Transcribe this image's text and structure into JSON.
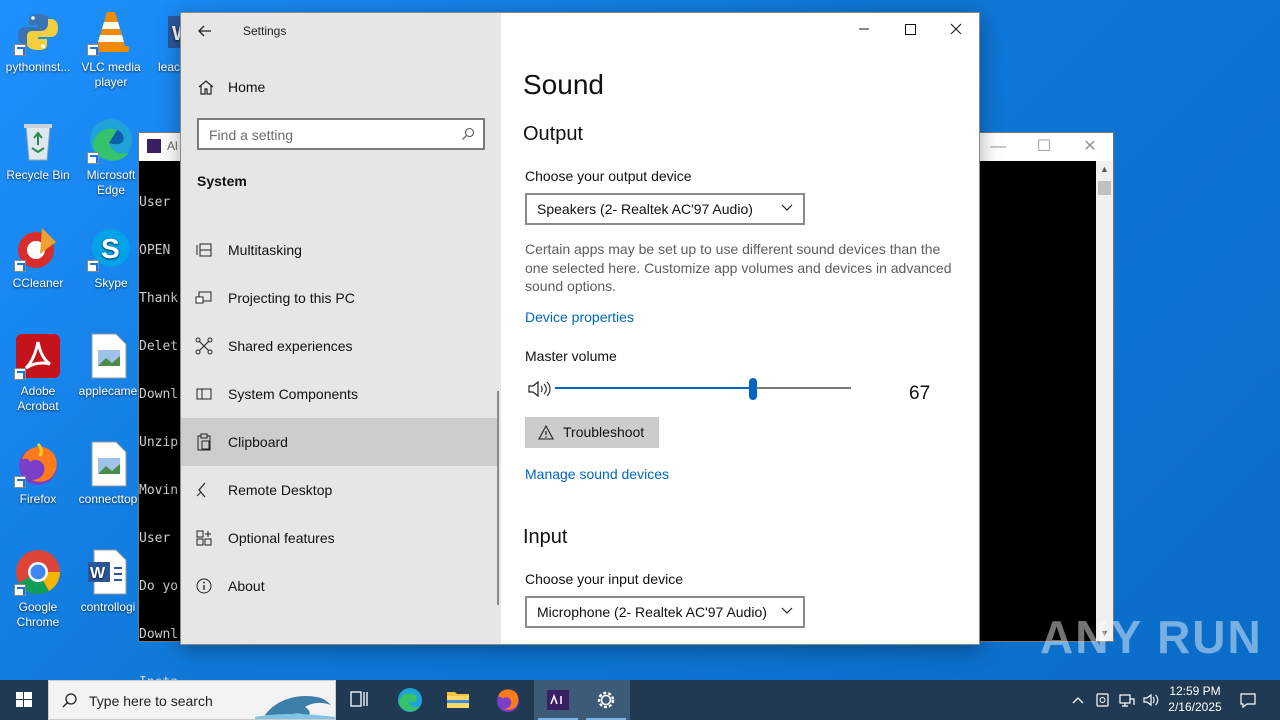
{
  "desktop": {
    "icons": [
      {
        "label": "pythoninst...",
        "icon": "python-icon"
      },
      {
        "label": "VLC media player",
        "icon": "vlc-icon"
      },
      {
        "label": "leac",
        "icon": "word-icon"
      },
      {
        "label": "Recycle Bin",
        "icon": "recycle-bin-icon"
      },
      {
        "label": "Microsoft Edge",
        "icon": "edge-icon"
      },
      {
        "label": "CCleaner",
        "icon": "ccleaner-icon"
      },
      {
        "label": "Skype",
        "icon": "skype-icon"
      },
      {
        "label": "Adobe Acrobat",
        "icon": "acrobat-icon"
      },
      {
        "label": "applecame",
        "icon": "image-file-icon"
      },
      {
        "label": "Firefox",
        "icon": "firefox-icon"
      },
      {
        "label": "connecttop",
        "icon": "image-file-icon"
      },
      {
        "label": "Google Chrome",
        "icon": "chrome-icon"
      },
      {
        "label": "controllogi",
        "icon": "word-doc-icon"
      }
    ]
  },
  "console": {
    "title": "Al",
    "lines": [
      "User",
      "OPEN",
      "Thank",
      "Delet",
      "Downl",
      "Unzip",
      "Movin",
      "User",
      "Do yo",
      "Downl",
      "Insta"
    ]
  },
  "settings": {
    "window_title": "Settings",
    "nav": {
      "home_label": "Home",
      "search_placeholder": "Find a setting",
      "section_title": "System",
      "items": [
        {
          "label": "Multitasking",
          "icon": "multitasking-icon"
        },
        {
          "label": "Projecting to this PC",
          "icon": "projecting-icon"
        },
        {
          "label": "Shared experiences",
          "icon": "shared-experiences-icon"
        },
        {
          "label": "System Components",
          "icon": "system-components-icon"
        },
        {
          "label": "Clipboard",
          "icon": "clipboard-icon",
          "selected": true
        },
        {
          "label": "Remote Desktop",
          "icon": "remote-desktop-icon"
        },
        {
          "label": "Optional features",
          "icon": "optional-features-icon"
        },
        {
          "label": "About",
          "icon": "info-icon"
        }
      ]
    },
    "content": {
      "page_title": "Sound",
      "output": {
        "heading": "Output",
        "device_label": "Choose your output device",
        "device_value": "Speakers (2- Realtek AC'97 Audio)",
        "description": "Certain apps may be set up to use different sound devices than the one selected here. Customize app volumes and devices in advanced sound options.",
        "device_properties_link": "Device properties",
        "master_volume_label": "Master volume",
        "master_volume_value": 67,
        "master_volume_display": "67",
        "troubleshoot_label": "Troubleshoot",
        "manage_link": "Manage sound devices"
      },
      "input": {
        "heading": "Input",
        "device_label": "Choose your input device",
        "device_value": "Microphone (2- Realtek AC'97 Audio)"
      }
    }
  },
  "taskbar": {
    "search_placeholder": "Type here to search",
    "apps": [
      "task-view-icon",
      "edge-icon",
      "file-explorer-icon",
      "firefox-icon",
      "anyrun-app-icon",
      "settings-gear-icon"
    ],
    "time": "12:59 PM",
    "date": "2/16/2025"
  },
  "watermark": "ANY RUN",
  "colors": {
    "accent": "#0067c0",
    "desktop": "#0f78d7",
    "taskbar": "#1f3a52"
  }
}
